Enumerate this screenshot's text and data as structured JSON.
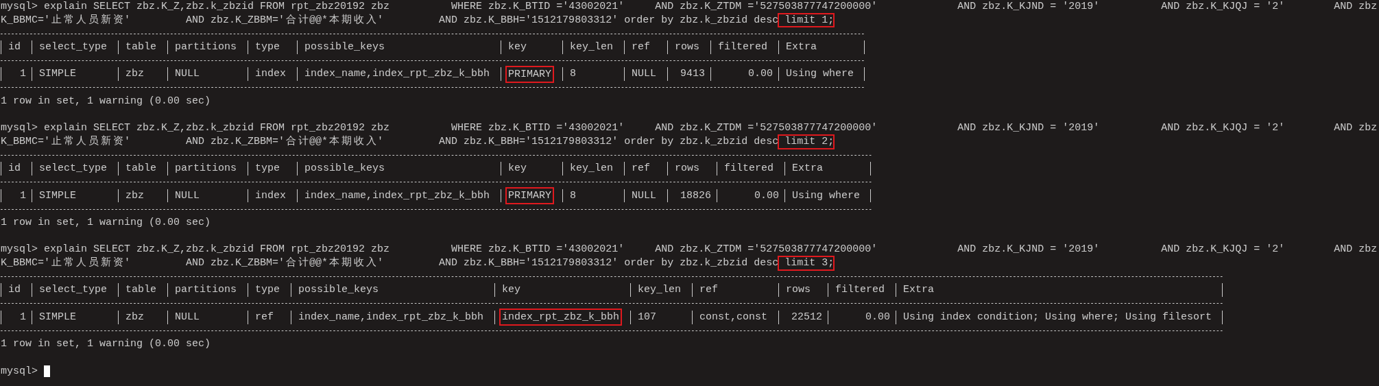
{
  "blocks": [
    {
      "query_lines": [
        [
          {
            "text": "mysql> explain SELECT zbz.K_Z,zbz.k_zbzid FROM rpt_zbz20192 zbz          WHERE zbz.K_BTID ='43002021'     AND zbz.K_ZTDM ='527503877747200000'             AND zbz.K_KJND = '2019'          AND zbz.K_KJQJ = '2'        AND zbz",
            "highlighted": false
          }
        ],
        [
          {
            "text": "K_BBMC='止常人员新资'         AND zbz.K_ZBBM='合计@@*本期收入'         AND zbz.K_BBH='1512179803312' order by zbz.k_zbzid desc",
            "highlighted": false
          },
          {
            "text": " limit 1;",
            "highlighted": true
          }
        ]
      ],
      "columns": [
        {
          "name": "id",
          "numeric": true
        },
        {
          "name": "select_type",
          "numeric": false
        },
        {
          "name": "table",
          "numeric": false
        },
        {
          "name": "partitions",
          "numeric": false
        },
        {
          "name": "type",
          "numeric": false
        },
        {
          "name": "possible_keys",
          "numeric": false
        },
        {
          "name": "key",
          "numeric": false
        },
        {
          "name": "key_len",
          "numeric": false
        },
        {
          "name": "ref",
          "numeric": false
        },
        {
          "name": "rows",
          "numeric": true
        },
        {
          "name": "filtered",
          "numeric": true
        },
        {
          "name": "Extra",
          "numeric": false
        }
      ],
      "cells": [
        {
          "text": "1",
          "highlighted": false
        },
        {
          "text": "SIMPLE",
          "highlighted": false
        },
        {
          "text": "zbz",
          "highlighted": false
        },
        {
          "text": "NULL",
          "highlighted": false
        },
        {
          "text": "index",
          "highlighted": false
        },
        {
          "text": "index_name,index_rpt_zbz_k_bbh",
          "highlighted": false
        },
        {
          "text": "PRIMARY",
          "highlighted": true
        },
        {
          "text": "8",
          "highlighted": false
        },
        {
          "text": "NULL",
          "highlighted": false
        },
        {
          "text": "9413",
          "highlighted": false
        },
        {
          "text": "0.00",
          "highlighted": false
        },
        {
          "text": "Using where",
          "highlighted": false
        }
      ],
      "result": "1 row in set, 1 warning (0.00 sec)"
    },
    {
      "query_lines": [
        [
          {
            "text": "mysql> explain SELECT zbz.K_Z,zbz.k_zbzid FROM rpt_zbz20192 zbz          WHERE zbz.K_BTID ='43002021'     AND zbz.K_ZTDM ='527503877747200000'             AND zbz.K_KJND = '2019'          AND zbz.K_KJQJ = '2'        AND zbz",
            "highlighted": false
          }
        ],
        [
          {
            "text": "K_BBMC='止常人员新资'         AND zbz.K_ZBBM='合计@@*本期收入'         AND zbz.K_BBH='1512179803312' order by zbz.k_zbzid desc",
            "highlighted": false
          },
          {
            "text": " limit 2;",
            "highlighted": true
          }
        ]
      ],
      "columns": [
        {
          "name": "id",
          "numeric": true
        },
        {
          "name": "select_type",
          "numeric": false
        },
        {
          "name": "table",
          "numeric": false
        },
        {
          "name": "partitions",
          "numeric": false
        },
        {
          "name": "type",
          "numeric": false
        },
        {
          "name": "possible_keys",
          "numeric": false
        },
        {
          "name": "key",
          "numeric": false
        },
        {
          "name": "key_len",
          "numeric": false
        },
        {
          "name": "ref",
          "numeric": false
        },
        {
          "name": "rows",
          "numeric": true
        },
        {
          "name": "filtered",
          "numeric": true
        },
        {
          "name": "Extra",
          "numeric": false
        }
      ],
      "cells": [
        {
          "text": "1",
          "highlighted": false
        },
        {
          "text": "SIMPLE",
          "highlighted": false
        },
        {
          "text": "zbz",
          "highlighted": false
        },
        {
          "text": "NULL",
          "highlighted": false
        },
        {
          "text": "index",
          "highlighted": false
        },
        {
          "text": "index_name,index_rpt_zbz_k_bbh",
          "highlighted": false
        },
        {
          "text": "PRIMARY",
          "highlighted": true
        },
        {
          "text": "8",
          "highlighted": false
        },
        {
          "text": "NULL",
          "highlighted": false
        },
        {
          "text": "18826",
          "highlighted": false
        },
        {
          "text": "0.00",
          "highlighted": false
        },
        {
          "text": "Using where",
          "highlighted": false
        }
      ],
      "result": "1 row in set, 1 warning (0.00 sec)"
    },
    {
      "query_lines": [
        [
          {
            "text": "mysql> explain SELECT zbz.K_Z,zbz.k_zbzid FROM rpt_zbz20192 zbz          WHERE zbz.K_BTID ='43002021'     AND zbz.K_ZTDM ='527503877747200000'             AND zbz.K_KJND = '2019'          AND zbz.K_KJQJ = '2'        AND zbz",
            "highlighted": false
          }
        ],
        [
          {
            "text": "K_BBMC='止常人员新资'         AND zbz.K_ZBBM='合计@@*本期收入'         AND zbz.K_BBH='1512179803312' order by zbz.k_zbzid desc",
            "highlighted": false
          },
          {
            "text": " limit 3;",
            "highlighted": true
          }
        ]
      ],
      "columns": [
        {
          "name": "id",
          "numeric": true
        },
        {
          "name": "select_type",
          "numeric": false
        },
        {
          "name": "table",
          "numeric": false
        },
        {
          "name": "partitions",
          "numeric": false
        },
        {
          "name": "type",
          "numeric": false
        },
        {
          "name": "possible_keys",
          "numeric": false
        },
        {
          "name": "key",
          "numeric": false
        },
        {
          "name": "key_len",
          "numeric": false
        },
        {
          "name": "ref",
          "numeric": false
        },
        {
          "name": "rows",
          "numeric": true
        },
        {
          "name": "filtered",
          "numeric": true
        },
        {
          "name": "Extra",
          "numeric": false
        }
      ],
      "cells": [
        {
          "text": "1",
          "highlighted": false
        },
        {
          "text": "SIMPLE",
          "highlighted": false
        },
        {
          "text": "zbz",
          "highlighted": false
        },
        {
          "text": "NULL",
          "highlighted": false
        },
        {
          "text": "ref",
          "highlighted": false
        },
        {
          "text": "index_name,index_rpt_zbz_k_bbh",
          "highlighted": false
        },
        {
          "text": "index_rpt_zbz_k_bbh",
          "highlighted": true
        },
        {
          "text": "107",
          "highlighted": false
        },
        {
          "text": "const,const",
          "highlighted": false
        },
        {
          "text": "22512",
          "highlighted": false
        },
        {
          "text": "0.00",
          "highlighted": false
        },
        {
          "text": "Using index condition; Using where; Using filesort",
          "highlighted": false
        }
      ],
      "result": "1 row in set, 1 warning (0.00 sec)"
    }
  ],
  "prompt": "mysql>"
}
